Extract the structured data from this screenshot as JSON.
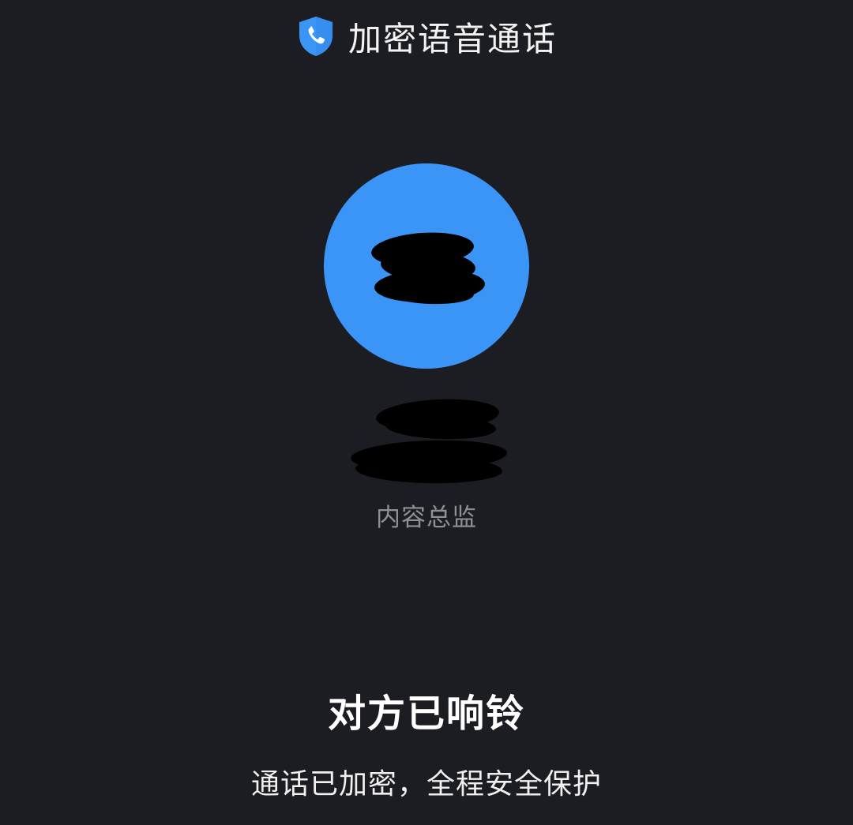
{
  "header": {
    "title": "加密语音通话",
    "icon": "shield-phone-icon",
    "icon_color": "#3a95f7"
  },
  "contact": {
    "avatar_text": "",
    "avatar_color": "#3a95f7",
    "name": "",
    "department": "",
    "job_title": "内容总监"
  },
  "call": {
    "status": "对方已响铃",
    "encryption_note": "通话已加密，全程安全保护"
  },
  "colors": {
    "background": "#1c1d22",
    "secondary_text": "#8f9095"
  }
}
